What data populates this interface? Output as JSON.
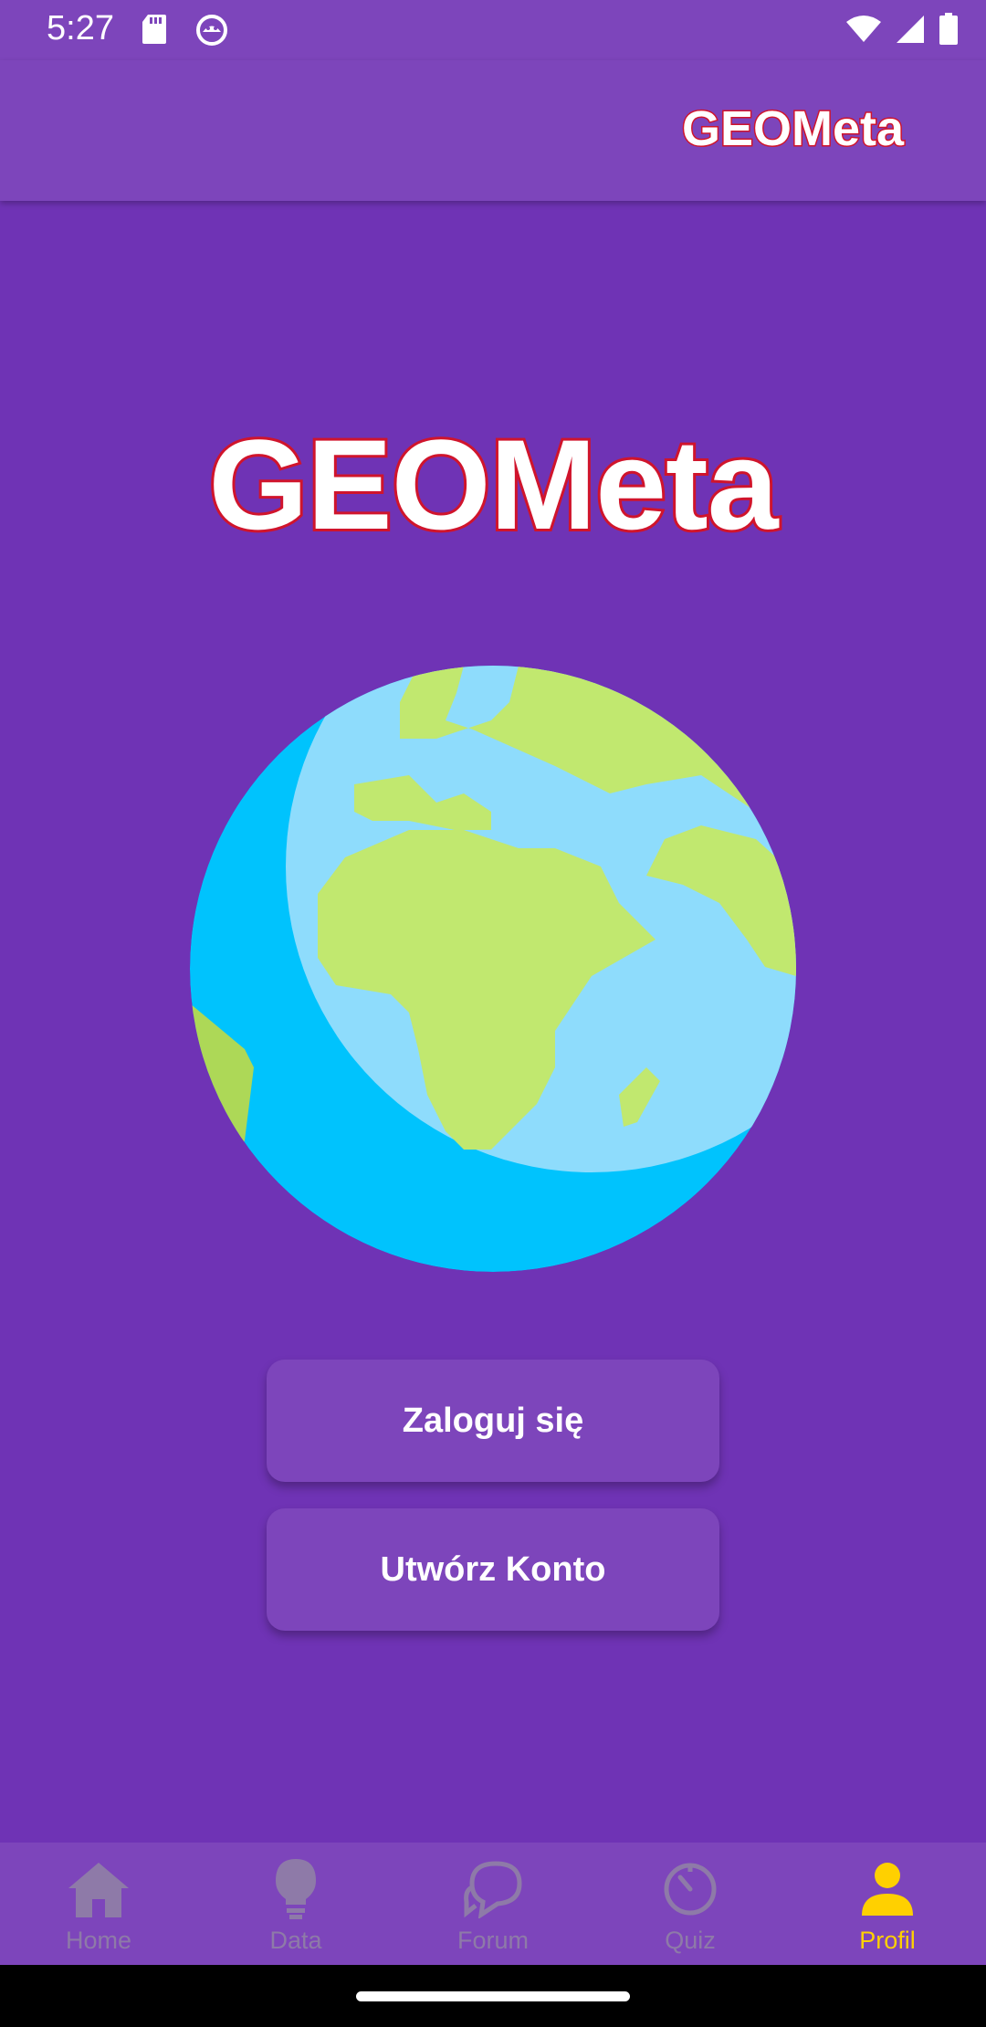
{
  "status_bar": {
    "time": "5:27",
    "left_icons": [
      "sd-card-icon",
      "android-debug-icon"
    ],
    "right_icons": [
      "wifi-icon",
      "signal-icon",
      "battery-icon"
    ]
  },
  "app_bar": {
    "title": "GEOMeta"
  },
  "hero": {
    "title": "GEOMeta",
    "image": "earth-globe-icon"
  },
  "buttons": {
    "login_label": "Zaloguj się",
    "register_label": "Utwórz Konto"
  },
  "bottom_nav": {
    "items": [
      {
        "label": "Home",
        "icon": "home-icon",
        "active": false
      },
      {
        "label": "Data",
        "icon": "lightbulb-icon",
        "active": false
      },
      {
        "label": "Forum",
        "icon": "chat-bubbles-icon",
        "active": false
      },
      {
        "label": "Quiz",
        "icon": "timer-icon",
        "active": false
      },
      {
        "label": "Profil",
        "icon": "person-icon",
        "active": true
      }
    ]
  },
  "colors": {
    "background": "#6f33b5",
    "bar": "#7d45bb",
    "title_stroke": "#d0142c",
    "active_nav": "#ffd000",
    "inactive_nav": "#8e7aa8"
  }
}
